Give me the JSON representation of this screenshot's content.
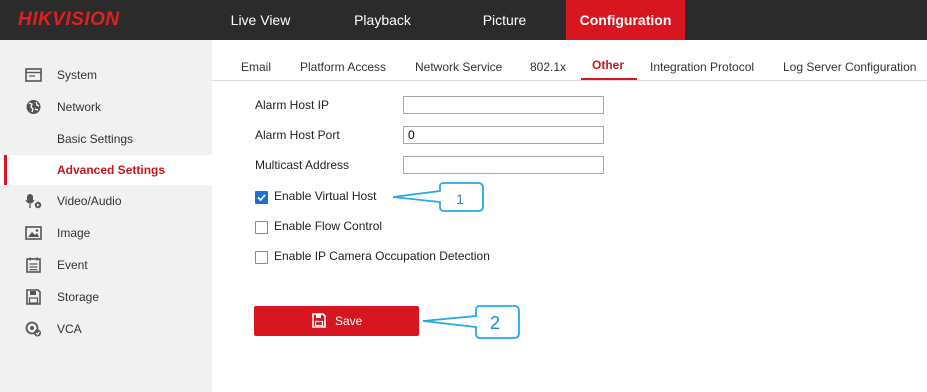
{
  "app": {
    "logo": "HIKVISION"
  },
  "topnav": [
    {
      "label": "Live View"
    },
    {
      "label": "Playback"
    },
    {
      "label": "Picture"
    },
    {
      "label": "Configuration",
      "active": true
    }
  ],
  "sidebar": {
    "items": [
      {
        "label": "System",
        "icon": "system-icon"
      },
      {
        "label": "Network",
        "icon": "globe-icon"
      },
      {
        "label": "Basic Settings"
      },
      {
        "label": "Advanced Settings",
        "active": true
      },
      {
        "label": "Video/Audio",
        "icon": "video-audio-icon"
      },
      {
        "label": "Image",
        "icon": "image-icon"
      },
      {
        "label": "Event",
        "icon": "event-icon"
      },
      {
        "label": "Storage",
        "icon": "storage-icon"
      },
      {
        "label": "VCA",
        "icon": "vca-icon"
      }
    ]
  },
  "tabs": [
    {
      "label": "Email"
    },
    {
      "label": "Platform Access"
    },
    {
      "label": "Network Service"
    },
    {
      "label": "802.1x"
    },
    {
      "label": "Other",
      "active": true
    },
    {
      "label": "Integration Protocol"
    },
    {
      "label": "Log Server Configuration"
    }
  ],
  "form": {
    "alarm_host_ip": {
      "label": "Alarm Host IP",
      "value": ""
    },
    "alarm_host_port": {
      "label": "Alarm Host Port",
      "value": "0"
    },
    "multicast_address": {
      "label": "Multicast Address",
      "value": ""
    },
    "enable_virtual_host": {
      "label": "Enable Virtual Host",
      "checked": true
    },
    "enable_flow_control": {
      "label": "Enable Flow Control",
      "checked": false
    },
    "enable_ip_camera_occupation": {
      "label": "Enable IP Camera Occupation Detection",
      "checked": false
    }
  },
  "save_button": {
    "label": "Save"
  },
  "callouts": [
    {
      "label": "1"
    },
    {
      "label": "2"
    }
  ],
  "colors": {
    "accent": "#d7161f",
    "topbar": "#2b2b2b",
    "sidebar": "#f1f1f1",
    "callout": "#29a8e0",
    "checkbox": "#1f6fd6"
  }
}
